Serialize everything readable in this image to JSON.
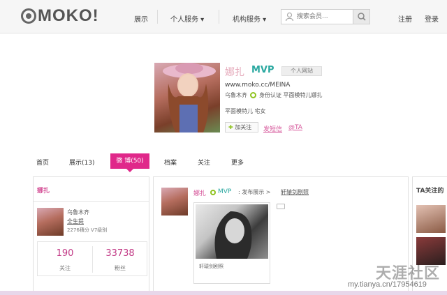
{
  "header": {
    "logo": "MOKO!",
    "nav": [
      "展示",
      "个人服务 ▾",
      "机构服务 ▾"
    ],
    "search_placeholder": "搜索会员...",
    "register": "注册",
    "login": "登录"
  },
  "profile": {
    "name": "娜扎",
    "badge": "MVP",
    "site_button": "个人网站",
    "url": "www.moko.cc/MEINA",
    "location": "乌鲁木齐",
    "verification": "身份认证 平面模特儿娜扎",
    "tags": "平面模特儿   宅女",
    "follow_label": "加关注",
    "message_link": "发短信",
    "at_link": "@TA"
  },
  "tabs": [
    "首页",
    "展示(13)",
    "微 博(50)",
    "档案",
    "关注",
    "更多"
  ],
  "active_tab_index": 2,
  "left_panel": {
    "title": "娜扎",
    "location": "乌鲁木齐",
    "education": "全生提",
    "score": "2276積分  V7级别",
    "following_count": "190",
    "following_label": "关注",
    "followers_count": "33738",
    "followers_label": "粉丝"
  },
  "feed": {
    "name": "娜扎",
    "badge": "MVP",
    "posted": ": 发布展示 >",
    "link": "轩辕剑剧照",
    "caption": "轩辕剑剧照"
  },
  "right_panel": {
    "title": "TA关注的"
  },
  "watermark": {
    "brand": "天涯社区",
    "url": "my.tianya.cn/17954619"
  },
  "colors": {
    "accent_pink": "#e0288a",
    "link_pink": "#d6569a",
    "mvp_teal": "#2aa8a0",
    "verify_green": "#8fc31f"
  }
}
